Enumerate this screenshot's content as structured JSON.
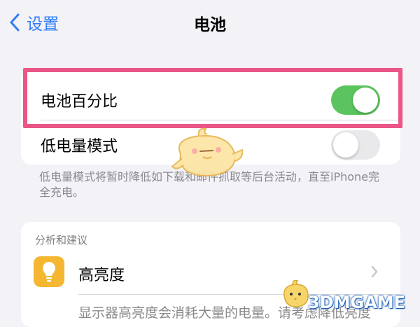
{
  "nav": {
    "back_label": "设置",
    "title": "电池"
  },
  "battery_group": {
    "percentage": {
      "label": "电池百分比",
      "state": "on"
    },
    "low_power": {
      "label": "低电量模式",
      "state": "off"
    },
    "footer": "低电量模式将暂时降低如下载和邮件抓取等后台活动，直至iPhone完全充电。"
  },
  "insights": {
    "header": "分析和建议",
    "brightness": {
      "label": "高亮度",
      "icon": "lightbulb-icon",
      "description": "显示器高亮度会消耗大量的电量。请考虑降低亮度"
    }
  },
  "watermark": "3DMGAME",
  "colors": {
    "accent": "#2f7cf6",
    "toggle_on": "#5bc45e",
    "highlight": "#ea5686",
    "icon_bg": "#f5b731"
  }
}
